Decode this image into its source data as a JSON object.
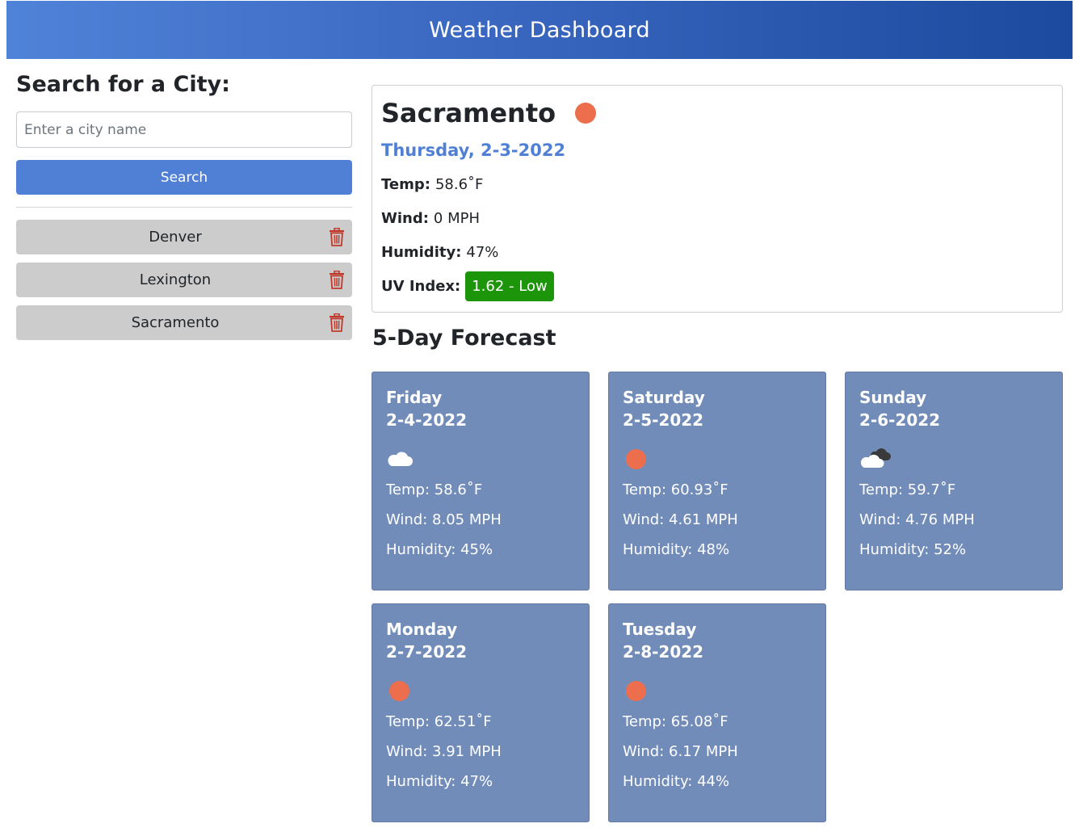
{
  "header": {
    "title": "Weather Dashboard"
  },
  "sidebar": {
    "heading": "Search for a City:",
    "search_placeholder": "Enter a city name",
    "search_button": "Search",
    "history": [
      {
        "city": "Denver"
      },
      {
        "city": "Lexington"
      },
      {
        "city": "Sacramento"
      }
    ]
  },
  "current": {
    "city": "Sacramento",
    "icon": "sun-icon",
    "date": "Thursday, 2-3-2022",
    "temp_label": "Temp:",
    "temp": "58.6˚F",
    "wind_label": "Wind:",
    "wind": "0 MPH",
    "humidity_label": "Humidity:",
    "humidity": "47%",
    "uv_label": "UV Index:",
    "uv": "1.62 - Low",
    "uv_color": "#1d950b"
  },
  "forecast": {
    "title": "5-Day Forecast",
    "days": [
      {
        "day": "Friday",
        "date": "2-4-2022",
        "icon": "cloud-icon",
        "temp": "Temp: 58.6˚F",
        "wind": "Wind: 8.05 MPH",
        "humidity": "Humidity: 45%"
      },
      {
        "day": "Saturday",
        "date": "2-5-2022",
        "icon": "sun-icon",
        "temp": "Temp: 60.93˚F",
        "wind": "Wind: 4.61 MPH",
        "humidity": "Humidity: 48%"
      },
      {
        "day": "Sunday",
        "date": "2-6-2022",
        "icon": "broken-clouds-icon",
        "temp": "Temp: 59.7˚F",
        "wind": "Wind: 4.76 MPH",
        "humidity": "Humidity: 52%"
      },
      {
        "day": "Monday",
        "date": "2-7-2022",
        "icon": "sun-icon",
        "temp": "Temp: 62.51˚F",
        "wind": "Wind: 3.91 MPH",
        "humidity": "Humidity: 47%"
      },
      {
        "day": "Tuesday",
        "date": "2-8-2022",
        "icon": "sun-icon",
        "temp": "Temp: 65.08˚F",
        "wind": "Wind: 6.17 MPH",
        "humidity": "Humidity: 44%"
      }
    ]
  },
  "colors": {
    "accent": "#4f80d6",
    "card": "#728cba",
    "sun": "#ec6e4c",
    "history_bg": "#cccccc",
    "trash": "#c0392b"
  }
}
